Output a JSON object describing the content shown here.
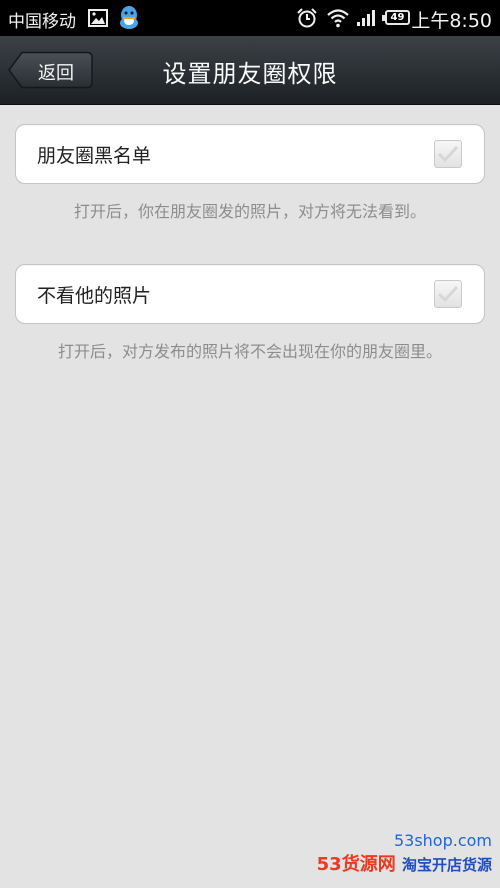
{
  "status_bar": {
    "carrier": "中国移动",
    "battery": "49",
    "time": "上午8:50",
    "icons": [
      "image-icon",
      "qq-icon",
      "alarm-icon",
      "wifi-icon",
      "signal-icon",
      "battery-icon"
    ]
  },
  "title_bar": {
    "back_label": "返回",
    "title": "设置朋友圈权限"
  },
  "settings": [
    {
      "label": "朋友圈黑名单",
      "checked": false,
      "hint": "打开后，你在朋友圈发的照片，对方将无法看到。"
    },
    {
      "label": "不看他的照片",
      "checked": false,
      "hint": "打开后，对方发布的照片将不会出现在你的朋友圈里。"
    }
  ],
  "watermark": {
    "site": "53shop.com",
    "brand": "53货源网",
    "tagline": "淘宝开店货源"
  }
}
